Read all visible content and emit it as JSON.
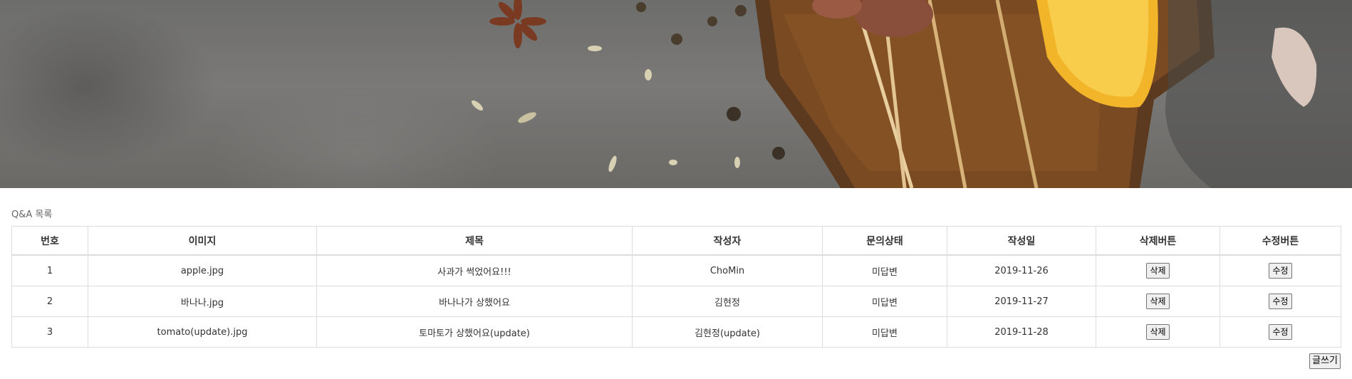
{
  "header": {
    "image_alt": "food-banner-image"
  },
  "qa_list": {
    "title": "Q&A 목록",
    "columns": [
      "번호",
      "이미지",
      "제목",
      "작성자",
      "문의상태",
      "작성일",
      "삭제버튼",
      "수정버튼"
    ],
    "rows": [
      {
        "no": "1",
        "image": "apple.jpg",
        "subject": "사과가 썩었어요!!!",
        "writer": "ChoMin",
        "status": "미답변",
        "date": "2019-11-26",
        "delete_label": "삭제",
        "edit_label": "수정"
      },
      {
        "no": "2",
        "image": "바나나.jpg",
        "subject": "바나나가 상했어요",
        "writer": "김현정",
        "status": "미답변",
        "date": "2019-11-27",
        "delete_label": "삭제",
        "edit_label": "수정"
      },
      {
        "no": "3",
        "image": "tomato(update).jpg",
        "subject": "토마토가 상했어요(update)",
        "writer": "김현정(update)",
        "status": "미답변",
        "date": "2019-11-28",
        "delete_label": "삭제",
        "edit_label": "수정"
      }
    ],
    "write_label": "글쓰기"
  }
}
